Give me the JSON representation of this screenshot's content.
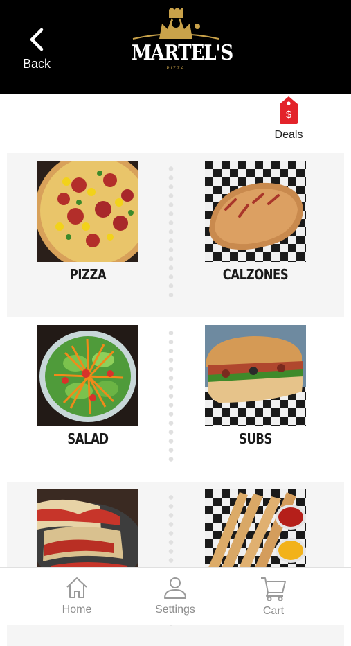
{
  "header": {
    "back_label": "Back",
    "logo_text": "MARTEL'S",
    "logo_sub": "PIZZA",
    "background": "#000000",
    "accent": "#c9a24a"
  },
  "deals": {
    "label": "Deals",
    "icon": "price-tag-icon",
    "icon_glyph": "$",
    "color": "#e3232a"
  },
  "categories": [
    {
      "label": "PIZZA",
      "image": "pizza-photo"
    },
    {
      "label": "CALZONES",
      "image": "calzone-photo"
    },
    {
      "label": "SALAD",
      "image": "salad-photo"
    },
    {
      "label": "SUBS",
      "image": "sub-sandwich-photo"
    },
    {
      "label": "",
      "image": "lasagna-photo"
    },
    {
      "label": "",
      "image": "breadsticks-photo"
    }
  ],
  "tabbar": {
    "items": [
      {
        "label": "Home",
        "icon": "home-icon"
      },
      {
        "label": "Settings",
        "icon": "user-icon"
      },
      {
        "label": "Cart",
        "icon": "cart-icon"
      }
    ]
  }
}
